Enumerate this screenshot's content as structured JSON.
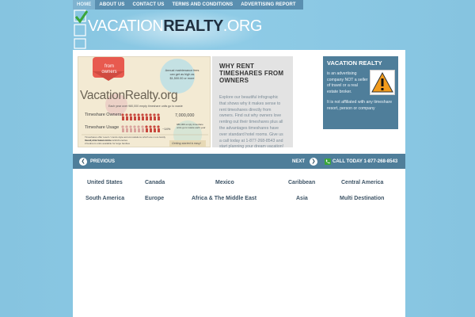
{
  "nav": {
    "items": [
      {
        "label": "HOME"
      },
      {
        "label": "ABOUT US"
      },
      {
        "label": "CONTACT US"
      },
      {
        "label": "TERMS AND CONDITIONS"
      },
      {
        "label": "ADVERTISING REPORT"
      }
    ]
  },
  "logo": {
    "vacation": "VACATION",
    "realty": "REALTY",
    "org": ".ORG"
  },
  "infographic": {
    "from_owners": "from owners",
    "maintenance": "Annual maintenance fees can get as high as $1,500.00 or more",
    "brand": "VacationRealty.org",
    "each_year": "Each year over 980,000 empty timeshare units go to waste",
    "owners_label": "Timeshare Owners",
    "owners_value": "7,000,000",
    "usage_label": "Timeshare Usage",
    "usage_pct": "~14%",
    "usage_note": "980,000 empty timeshare units go to waste each year",
    "bullet1": "Timeshares offer resort / condo style accommodations which are more family friendly than hotel rooms",
    "bullet2": "Guest units feature kitchens/kitchenettes",
    "bullet3": "2 bedroom units available for large families",
    "getting_started": "Getting started is easy!"
  },
  "why": {
    "title": "WHY RENT TIMESHARES FROM OWNERS",
    "body": "Explore our beautiful infographic that shows why it makes sense to rent timeshares directly from owners. Find out why owners love renting out their timeshares plus all the advantages timeshares have over standard hotel rooms. Give us a call today at 1-877-268-8543 and start planning your dream vacation!"
  },
  "sidebar": {
    "title": "VACATION REALTY",
    "text1": "is an advertising company NOT a seller of travel or a real estate broker.",
    "text2": "It is not affiliated with any timeshare resort, person or company"
  },
  "slider": {
    "previous": "PREVIOUS",
    "next": "NEXT",
    "call": "CALL TODAY 1-877-268-8543"
  },
  "regions": [
    {
      "label": "United States"
    },
    {
      "label": "Canada"
    },
    {
      "label": "Mexico"
    },
    {
      "label": "Caribbean"
    },
    {
      "label": "Central America"
    },
    {
      "label": "South America"
    },
    {
      "label": "Europe"
    },
    {
      "label": "Africa & The Middle East"
    },
    {
      "label": "Asia"
    },
    {
      "label": "Multi Destination"
    }
  ],
  "colors": {
    "background": "#8ecbe6",
    "nav_bar": "#5a8fb0",
    "panel_blue": "#4f7e9a",
    "accent_green": "#3aa63a",
    "infographic_red": "#c0392b"
  }
}
